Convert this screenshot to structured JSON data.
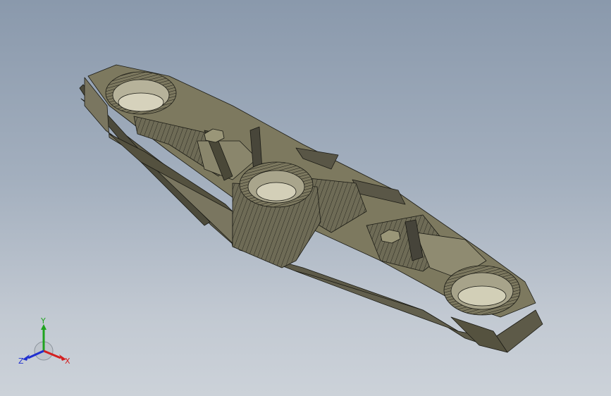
{
  "viewport": {
    "background_top": "#8a99ac",
    "background_bottom": "#ccd2d9",
    "model_fill": "#6e6b56",
    "model_fill_light": "#878369",
    "model_fill_dark": "#4f4c3c",
    "edge_color": "#1a1a14"
  },
  "triad": {
    "x_label": "X",
    "y_label": "Y",
    "z_label": "Z",
    "x_color": "#d42020",
    "y_color": "#1fa31f",
    "z_color": "#2030d0"
  }
}
